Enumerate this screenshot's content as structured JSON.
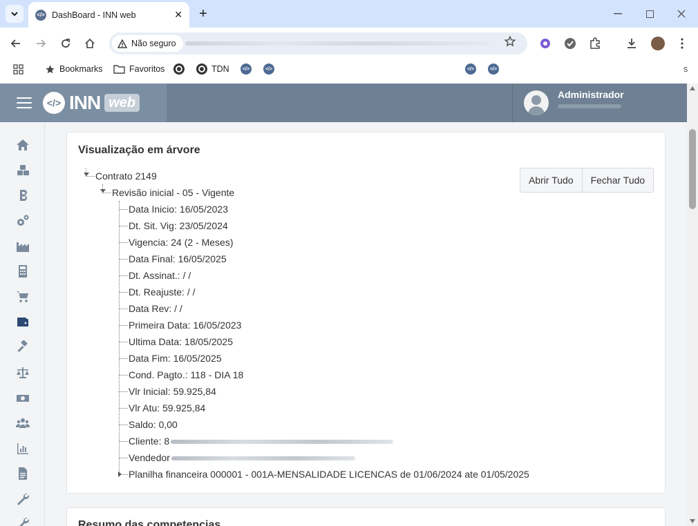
{
  "browser": {
    "tab_title": "DashBoard - INN web",
    "security_label": "Não seguro",
    "bookmarks": {
      "bookmarks_label": "Bookmarks",
      "favoritos_label": "Favoritos",
      "tdn_label": "TDN",
      "trailing": "s"
    }
  },
  "header": {
    "logo_inn": "INN",
    "logo_web": "web",
    "user_name": "Administrador"
  },
  "sidebar": {
    "icons": [
      "home-icon",
      "cubes-icon",
      "bitcoin-icon",
      "gears-icon",
      "industry-icon",
      "calculator-icon",
      "cart-icon",
      "wallet-icon",
      "gavel-icon",
      "scale-icon",
      "money-icon",
      "users-icon",
      "bar-chart-icon",
      "document-icon",
      "wrench-icon",
      "tools-icon"
    ]
  },
  "tree_card": {
    "title": "Visualização em árvore",
    "open_all": "Abrir Tudo",
    "close_all": "Fechar Tudo",
    "root": "Contrato 2149",
    "revision": "Revisão inicial - 05 - Vigente",
    "items": [
      "Data Inicio: 16/05/2023",
      "Dt. Sit. Vig: 23/05/2024",
      "Vigencia: 24 (2 - Meses)",
      "Data Final: 16/05/2025",
      "Dt. Assinat.: / /",
      "Dt. Reajuste: / /",
      "Data Rev: / /",
      "Primeira Data: 16/05/2023",
      "Ultima Data: 18/05/2025",
      "Data Fim: 16/05/2025",
      "Cond. Pagto.: 118 - DIA 18",
      "Vlr Inicial: 59.925,84",
      "Vlr Atu: 59.925,84",
      "Saldo: 0,00",
      "Cliente: 8",
      "Vendedor"
    ],
    "planilha": "Planilha financeira 000001 - 001A-MENSALIDADE LICENCAS de 01/06/2024 ate 01/05/2025"
  },
  "summary_card": {
    "title": "Resumo das competencias"
  }
}
